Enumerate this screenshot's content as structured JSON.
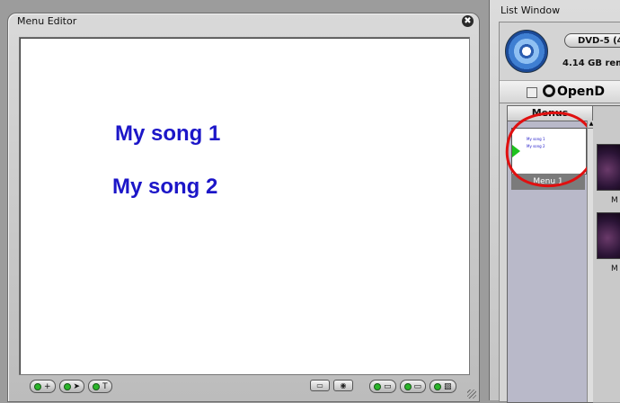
{
  "editor": {
    "title": "Menu Editor",
    "close_glyph": "✖",
    "canvas_items": [
      "My song 1",
      "My song 2"
    ],
    "left_tools": [
      {
        "icon": "plus-icon",
        "glyph": "+"
      },
      {
        "icon": "pointer-icon",
        "glyph": "➤"
      },
      {
        "icon": "text-icon",
        "glyph": "T"
      }
    ],
    "right_tools": [
      {
        "icon": "safe-area-icon",
        "glyph": "▭"
      },
      {
        "icon": "preview-icon",
        "glyph": "◉"
      },
      {
        "icon": "toggle-one-icon",
        "glyph": "▭"
      },
      {
        "icon": "toggle-two-icon",
        "glyph": "▭"
      },
      {
        "icon": "toggle-three-icon",
        "glyph": "▨"
      }
    ]
  },
  "list_window": {
    "title": "List Window",
    "dvd_button": "DVD-5 (4.",
    "remaining": "4.14 GB rem",
    "opendvd_label": "OpenD",
    "menus_header": "Menus",
    "menu_item_label": "Menu 1",
    "thumb_lines": [
      "My song 1",
      "My song 2"
    ],
    "clip_labels": [
      "M",
      "M"
    ]
  },
  "colors": {
    "song_text": "#1c16c8",
    "annotation": "#e01010"
  }
}
